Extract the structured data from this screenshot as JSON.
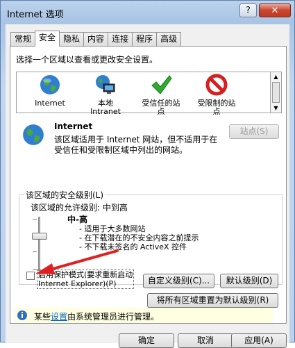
{
  "window": {
    "title": "Internet 选项",
    "help_label": "?",
    "close_label": "✕"
  },
  "tabs": [
    {
      "label": "常规"
    },
    {
      "label": "安全"
    },
    {
      "label": "隐私"
    },
    {
      "label": "内容"
    },
    {
      "label": "连接"
    },
    {
      "label": "程序"
    },
    {
      "label": "高级"
    }
  ],
  "security": {
    "instruction": "选择一个区域以查看或更改安全设置。",
    "zones": [
      {
        "label_line1": "Internet",
        "label_line2": "",
        "icon": "globe-icon"
      },
      {
        "label_line1": "本地",
        "label_line2": "Intranet",
        "icon": "intranet-icon"
      },
      {
        "label_line1": "受信任的站",
        "label_line2": "点",
        "icon": "checkmark-icon"
      },
      {
        "label_line1": "受限制的站",
        "label_line2": "点",
        "icon": "restricted-icon"
      }
    ],
    "selected_zone": {
      "name": "Internet",
      "desc_line1": "该区域适用于 Internet 网站，但不适用于在",
      "desc_line2": "受信任和受限制区域中列出的网站。"
    },
    "sites_button": "站点(S)",
    "level_group_label": "该区域的安全级别(L)",
    "allowed_levels": "该区域的允许级别: 中到高",
    "current_level": "中-高",
    "level_bullets": [
      "- 适用于大多数网站",
      "- 在下载潜在的不安全内容之前提示",
      "- 不下载未签名的 ActiveX 控件"
    ],
    "slider_level_fraction": 0.5,
    "protected_mode_line1": "启用保护模式(要求重新启动",
    "protected_mode_line2": "Internet Explorer)(P)",
    "protected_mode_checked": false,
    "custom_level_button": "自定义级别(C)...",
    "default_level_button": "默认级别(D)",
    "reset_all_button": "将所有区域重置为默认级别(R)",
    "notice_prefix": "某些",
    "notice_link": "设置",
    "notice_suffix": "由系统管理员进行管理。"
  },
  "footer": {
    "ok": "确定",
    "cancel": "取消",
    "apply": "应用(A)"
  },
  "colors": {
    "accent_arrow": "#e02020",
    "notice_bg": "#ffffe1",
    "link": "#0066cc"
  }
}
